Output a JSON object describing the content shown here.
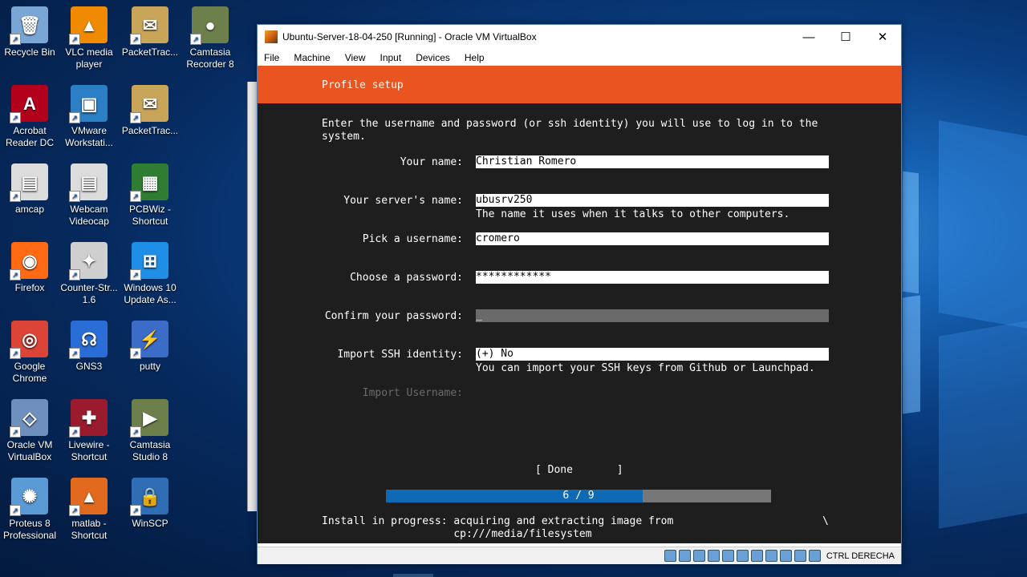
{
  "desktop": {
    "icons": [
      {
        "label": "Recycle Bin",
        "icon": "recycle-bin-icon",
        "color": "#7aa6d6",
        "glyph": "🗑"
      },
      {
        "label": "VLC media player",
        "icon": "vlc-icon",
        "color": "#f08a00",
        "glyph": "▲"
      },
      {
        "label": "PacketTrac...",
        "icon": "packet-tracer-icon",
        "color": "#c9a55a",
        "glyph": "✉"
      },
      {
        "label": "Camtasia Recorder 8",
        "icon": "camtasia-recorder-icon",
        "color": "#6d7f4a",
        "glyph": "●"
      },
      {
        "label": "Acrobat Reader DC",
        "icon": "acrobat-icon",
        "color": "#b3001b",
        "glyph": "A"
      },
      {
        "label": "VMware Workstati...",
        "icon": "vmware-icon",
        "color": "#2b7fc4",
        "glyph": "▣"
      },
      {
        "label": "PacketTrac...",
        "icon": "packet-tracer-icon",
        "color": "#c9a55a",
        "glyph": "✉"
      },
      {
        "label": "amcap",
        "icon": "amcap-icon",
        "color": "#dcdcdc",
        "glyph": "▤"
      },
      {
        "label": "Webcam Videocap",
        "icon": "webcam-icon",
        "color": "#dcdcdc",
        "glyph": "▤"
      },
      {
        "label": "PCBWiz - Shortcut",
        "icon": "pcbwiz-icon",
        "color": "#2e7d32",
        "glyph": "▦"
      },
      {
        "label": "Firefox",
        "icon": "firefox-icon",
        "color": "#ff6a13",
        "glyph": "◉"
      },
      {
        "label": "Counter-Str... 1.6",
        "icon": "counter-strike-icon",
        "color": "#cfcfcf",
        "glyph": "✦"
      },
      {
        "label": "Windows 10 Update As...",
        "icon": "windows-update-icon",
        "color": "#1e8ee6",
        "glyph": "⊞"
      },
      {
        "label": "Google Chrome",
        "icon": "chrome-icon",
        "color": "#db4437",
        "glyph": "◎"
      },
      {
        "label": "GNS3",
        "icon": "gns3-icon",
        "color": "#2a6dd6",
        "glyph": "☊"
      },
      {
        "label": "putty",
        "icon": "putty-icon",
        "color": "#3a6cc8",
        "glyph": "⚡"
      },
      {
        "label": "Oracle VM VirtualBox",
        "icon": "virtualbox-icon",
        "color": "#6f8fbf",
        "glyph": "◇"
      },
      {
        "label": "Livewire - Shortcut",
        "icon": "livewire-icon",
        "color": "#9b1b2e",
        "glyph": "✚"
      },
      {
        "label": "Camtasia Studio 8",
        "icon": "camtasia-studio-icon",
        "color": "#6d7f4a",
        "glyph": "▶"
      },
      {
        "label": "Proteus 8 Professional",
        "icon": "proteus-icon",
        "color": "#5b9bd5",
        "glyph": "✺"
      },
      {
        "label": "matlab - Shortcut",
        "icon": "matlab-icon",
        "color": "#e16a1e",
        "glyph": "▲"
      },
      {
        "label": "WinSCP",
        "icon": "winscp-icon",
        "color": "#2f6db5",
        "glyph": "🔒"
      }
    ]
  },
  "window": {
    "title": "Ubuntu-Server-18-04-250 [Running] - Oracle VM VirtualBox",
    "minimize": "—",
    "maximize": "☐",
    "close": "✕",
    "menu": [
      "File",
      "Machine",
      "View",
      "Input",
      "Devices",
      "Help"
    ]
  },
  "installer": {
    "header": "Profile setup",
    "intro": "Enter the username and password (or ssh identity) you will use to log in to the\nsystem.",
    "fields": {
      "name": {
        "label": "Your name:",
        "value": "Christian Romero"
      },
      "server": {
        "label": "Your server's name:",
        "value": "ubusrv250",
        "help": "The name it uses when it talks to other computers."
      },
      "username": {
        "label": "Pick a username:",
        "value": "cromero"
      },
      "password": {
        "label": "Choose a password:",
        "value": "************"
      },
      "confirm": {
        "label": "Confirm your password:",
        "value": "_"
      },
      "ssh": {
        "label": "Import SSH identity:",
        "value": "(+) No",
        "help": "You can import your SSH keys from Github or Launchpad."
      },
      "import_username": {
        "label": "Import Username:"
      }
    },
    "done_button": "[ Done       ]",
    "progress": {
      "text": "6 / 9",
      "fraction": 0.667
    },
    "install_status": "Install in progress: acquiring and extracting image from\n                     cp:///media/filesystem",
    "spinner": "\\"
  },
  "statusbar": {
    "host_key": "CTRL DERECHA",
    "icons": [
      "hdd-icon",
      "cd-icon",
      "audio-icon",
      "network-icon",
      "usb-icon",
      "shared-folder-icon",
      "display-icon",
      "video-capture-icon",
      "cpu-icon",
      "mouse-integration-icon",
      "recording-icon"
    ]
  },
  "colors": {
    "ubuntu_orange": "#e95420",
    "progress_blue": "#0e6ab5"
  }
}
